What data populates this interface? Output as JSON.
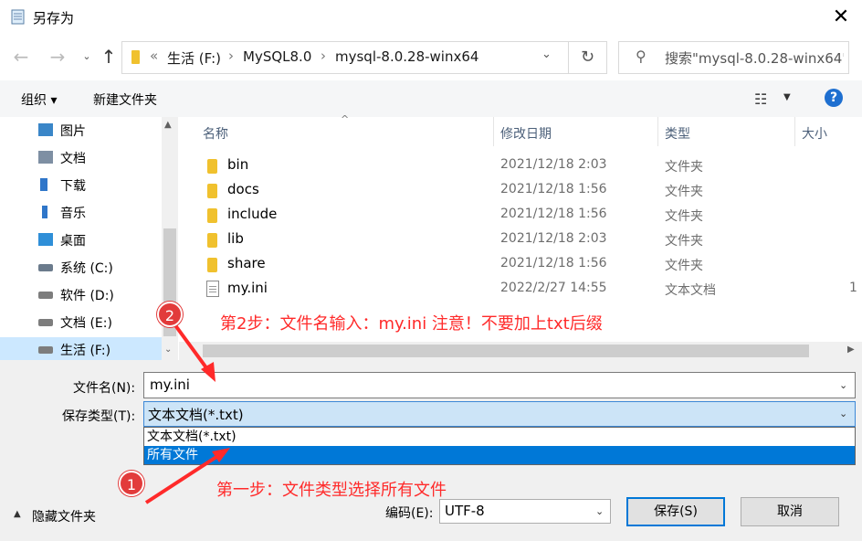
{
  "window": {
    "title": "另存为",
    "close_glyph": "✕"
  },
  "nav": {
    "back_glyph": "←",
    "forward_glyph": "→",
    "recent_glyph": "⌄",
    "up_glyph": "↑",
    "breadcrumb_overflow": "«",
    "breadcrumbs": [
      "生活 (F:)",
      "MySQL8.0",
      "mysql-8.0.28-winx64"
    ],
    "separator": "›",
    "refresh_glyph": "↻",
    "search_placeholder": "搜索\"mysql-8.0.28-winx64\""
  },
  "toolbar": {
    "organize": "组织 ▾",
    "new_folder": "新建文件夹",
    "view_glyph": "☷",
    "view_dd": "▼",
    "help": "?"
  },
  "sidebar": {
    "items": [
      {
        "label": "图片",
        "icon": "pictures-icon"
      },
      {
        "label": "文档",
        "icon": "documents-icon"
      },
      {
        "label": "下载",
        "icon": "downloads-icon"
      },
      {
        "label": "音乐",
        "icon": "music-icon"
      },
      {
        "label": "桌面",
        "icon": "desktop-icon"
      },
      {
        "label": "系统 (C:)",
        "icon": "drive-c-icon"
      },
      {
        "label": "软件 (D:)",
        "icon": "drive-icon"
      },
      {
        "label": "文档 (E:)",
        "icon": "drive-icon"
      },
      {
        "label": "生活 (F:)",
        "icon": "drive-icon",
        "selected": true
      }
    ]
  },
  "file_list": {
    "columns": [
      "名称",
      "修改日期",
      "类型",
      "大小"
    ],
    "sort_glyph": "^",
    "rows": [
      {
        "name": "bin",
        "date": "2021/12/18 2:03",
        "type": "文件夹",
        "size": "",
        "kind": "folder"
      },
      {
        "name": "docs",
        "date": "2021/12/18 1:56",
        "type": "文件夹",
        "size": "",
        "kind": "folder"
      },
      {
        "name": "include",
        "date": "2021/12/18 1:56",
        "type": "文件夹",
        "size": "",
        "kind": "folder"
      },
      {
        "name": "lib",
        "date": "2021/12/18 2:03",
        "type": "文件夹",
        "size": "",
        "kind": "folder"
      },
      {
        "name": "share",
        "date": "2021/12/18 1:56",
        "type": "文件夹",
        "size": "",
        "kind": "folder"
      },
      {
        "name": "my.ini",
        "date": "2022/2/27 14:55",
        "type": "文本文档",
        "size": "1",
        "kind": "text"
      }
    ]
  },
  "form": {
    "filename_label": "文件名(N):",
    "filename_value": "my.ini",
    "filetype_label": "保存类型(T):",
    "filetype_value": "文本文档(*.txt)",
    "filetype_options": [
      "文本文档(*.txt)",
      "所有文件"
    ],
    "hide_folders": "隐藏文件夹",
    "encoding_label": "编码(E):",
    "encoding_value": "UTF-8",
    "save": "保存(S)",
    "cancel": "取消"
  },
  "annotations": {
    "step2_badge": "2",
    "step2_text": "第2步：文件名输入：my.ini   注意！不要加上txt后缀",
    "step1_badge": "1",
    "step1_text": "第一步：文件类型选择所有文件",
    "color": "#ff2a2a"
  },
  "colors": {
    "accent": "#0078d7",
    "selection_bg": "#cce4f7",
    "folder": "#f0c12e",
    "annotation": "#ff2a2a"
  }
}
